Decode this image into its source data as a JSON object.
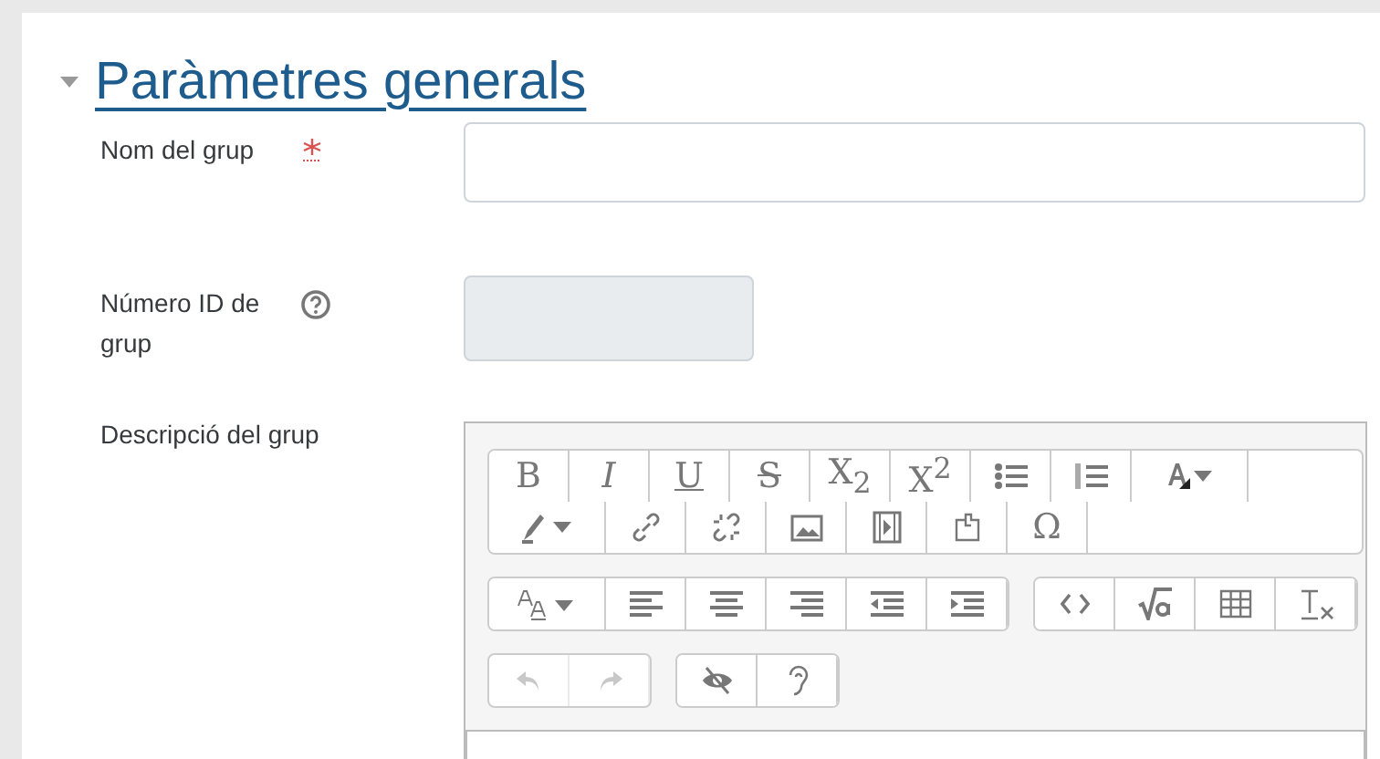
{
  "section": {
    "title": "Paràmetres generals",
    "expanded": true
  },
  "fields": [
    {
      "label": "Nom del grup",
      "kind": "required",
      "disabled": false
    },
    {
      "label": "Número ID de grup",
      "kind": "help",
      "disabled": true
    },
    {
      "label": "Descripció del grup",
      "kind": "editor"
    }
  ],
  "toolbar_rows": [
    {
      "groups": [
        {
          "buttons": [
            {
              "kind": "bold",
              "label": "B",
              "disabled": false
            },
            {
              "kind": "italic",
              "label": "I",
              "disabled": false
            },
            {
              "kind": "underline",
              "label": "U",
              "disabled": false
            },
            {
              "kind": "strike",
              "label": "S",
              "disabled": false
            },
            {
              "kind": "glyph",
              "label": "X$_{2}$",
              "disabled": false
            },
            {
              "kind": "glyph",
              "label": "X$^{2}$",
              "disabled": false
            },
            {
              "kind": "bullets",
              "disabled": false
            },
            {
              "kind": "numbers",
              "disabled": false
            },
            {
              "kind": "font-color",
              "disabled": false
            },
            {
              "kind": "highlight",
              "disabled": false
            },
            {
              "kind": "link",
              "disabled": false
            },
            {
              "kind": "unlink",
              "disabled": false
            },
            {
              "kind": "image",
              "disabled": false
            },
            {
              "kind": "media",
              "disabled": false
            },
            {
              "kind": "file",
              "disabled": false
            },
            {
              "kind": "glyph",
              "label": "Ω",
              "disabled": false
            }
          ]
        }
      ]
    },
    {
      "groups": [
        {
          "buttons": [
            {
              "kind": "font-size",
              "disabled": false
            },
            {
              "kind": "align-left",
              "disabled": false
            },
            {
              "kind": "align-center",
              "disabled": false
            },
            {
              "kind": "align-right",
              "disabled": false
            },
            {
              "kind": "outdent",
              "disabled": false
            },
            {
              "kind": "indent",
              "disabled": false
            }
          ]
        },
        {
          "buttons": [
            {
              "kind": "code",
              "disabled": false
            },
            {
              "kind": "equation",
              "disabled": false
            },
            {
              "kind": "table",
              "disabled": false
            },
            {
              "kind": "clear-format",
              "disabled": false
            }
          ]
        }
      ]
    },
    {
      "groups": [
        {
          "buttons": [
            {
              "kind": "undo",
              "disabled": true
            },
            {
              "kind": "redo",
              "disabled": true
            }
          ]
        },
        {
          "buttons": [
            {
              "kind": "accessibility",
              "disabled": false
            },
            {
              "kind": "screenreader",
              "disabled": false
            }
          ]
        }
      ]
    }
  ]
}
